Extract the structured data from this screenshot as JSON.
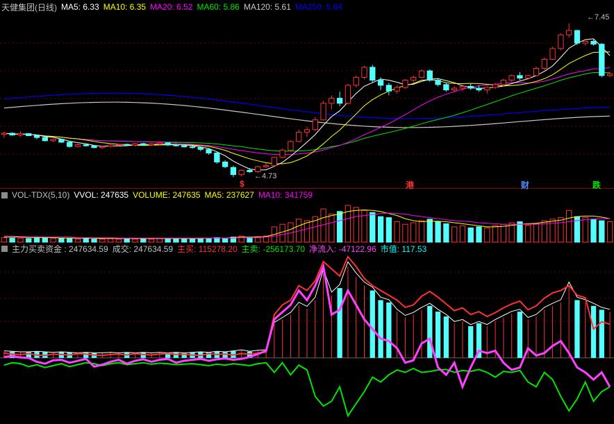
{
  "price_panel": {
    "title": "天健集团(日线)",
    "ma5_label": "MA5: 6.33",
    "ma10_label": "MA10: 6.35",
    "ma20_label": "MA20: 6.52",
    "ma60_label": "MA60: 5.86",
    "ma120_label": "MA120: 5.61",
    "ma250_label": "MA250: 5.64",
    "high_label": "7.45",
    "low_label": "4.73",
    "events": [
      "$",
      "港",
      "财",
      "跌"
    ]
  },
  "volume_panel": {
    "title": "VOL-TDX(5,10)",
    "vvol_label": "VVOL: 247635",
    "volume_label": "VOLUME: 247635",
    "ma5_label": "MA5: 237627",
    "ma10_label": "MA10: 341759"
  },
  "fund_panel": {
    "title": "主力买卖资金 : 247634.59",
    "deal_label": "成交: 247634.59",
    "buy_label": "主买: 115278.20",
    "sell_label": "主卖: -256173.70",
    "net_label": "净流入: -47122.96",
    "mktcap_label": "市值: 117.53"
  },
  "colors": {
    "up": "#ff3232",
    "down": "#54fcfc",
    "ma5": "#ffffff",
    "ma10": "#ffff00",
    "ma20": "#ff00ff",
    "ma60": "#00e600",
    "ma120": "#c8c8c8",
    "ma250": "#0000ff",
    "buy_line": "#ff3232",
    "sell_line": "#00e600",
    "net_line": "#ff40ff",
    "mktcap": "#00ffff"
  },
  "chart_data": {
    "type": "candlestick",
    "candles": [
      [
        5.92,
        6.0,
        5.82,
        5.95
      ],
      [
        5.95,
        5.97,
        5.88,
        5.9
      ],
      [
        5.9,
        6.0,
        5.85,
        5.94
      ],
      [
        5.94,
        5.95,
        5.87,
        5.88
      ],
      [
        5.88,
        5.9,
        5.78,
        5.83
      ],
      [
        5.83,
        5.86,
        5.72,
        5.74
      ],
      [
        5.74,
        5.8,
        5.7,
        5.78
      ],
      [
        5.78,
        5.8,
        5.68,
        5.7
      ],
      [
        5.7,
        5.73,
        5.55,
        5.58
      ],
      [
        5.58,
        5.66,
        5.55,
        5.63
      ],
      [
        5.63,
        5.66,
        5.58,
        5.6
      ],
      [
        5.6,
        5.62,
        5.53,
        5.55
      ],
      [
        5.55,
        5.6,
        5.52,
        5.58
      ],
      [
        5.58,
        5.64,
        5.55,
        5.62
      ],
      [
        5.62,
        5.66,
        5.6,
        5.64
      ],
      [
        5.64,
        5.66,
        5.6,
        5.62
      ],
      [
        5.62,
        5.68,
        5.58,
        5.66
      ],
      [
        5.66,
        5.68,
        5.6,
        5.62
      ],
      [
        5.62,
        5.68,
        5.6,
        5.65
      ],
      [
        5.65,
        5.7,
        5.62,
        5.68
      ],
      [
        5.68,
        5.7,
        5.6,
        5.62
      ],
      [
        5.62,
        5.66,
        5.58,
        5.6
      ],
      [
        5.6,
        5.64,
        5.55,
        5.57
      ],
      [
        5.57,
        5.6,
        5.52,
        5.55
      ],
      [
        5.55,
        5.58,
        5.45,
        5.5
      ],
      [
        5.5,
        5.52,
        5.35,
        5.4
      ],
      [
        5.4,
        5.42,
        5.1,
        5.15
      ],
      [
        5.15,
        5.2,
        4.98,
        5.02
      ],
      [
        5.0,
        5.05,
        4.73,
        4.8
      ],
      [
        4.8,
        4.95,
        4.75,
        4.92
      ],
      [
        4.92,
        4.98,
        4.85,
        4.88
      ],
      [
        4.88,
        5.05,
        4.85,
        5.02
      ],
      [
        5.02,
        5.12,
        4.98,
        5.05
      ],
      [
        5.05,
        5.3,
        5.02,
        5.28
      ],
      [
        5.28,
        5.52,
        5.25,
        5.48
      ],
      [
        5.48,
        5.75,
        5.45,
        5.72
      ],
      [
        5.72,
        6.05,
        5.7,
        5.98
      ],
      [
        5.98,
        6.12,
        5.85,
        6.05
      ],
      [
        6.05,
        6.4,
        6.0,
        6.32
      ],
      [
        6.32,
        6.85,
        6.3,
        6.78
      ],
      [
        6.78,
        7.0,
        6.62,
        6.92
      ],
      [
        6.92,
        7.1,
        6.7,
        6.78
      ],
      [
        6.78,
        7.32,
        6.75,
        7.28
      ],
      [
        7.28,
        7.55,
        7.22,
        7.5
      ],
      [
        7.5,
        7.82,
        7.45,
        7.78
      ],
      [
        7.78,
        7.85,
        7.35,
        7.42
      ],
      [
        7.42,
        7.5,
        7.15,
        7.28
      ],
      [
        7.28,
        7.35,
        7.0,
        7.12
      ],
      [
        7.12,
        7.28,
        7.05,
        7.22
      ],
      [
        7.22,
        7.45,
        7.18,
        7.42
      ],
      [
        7.42,
        7.55,
        7.35,
        7.5
      ],
      [
        7.5,
        7.72,
        7.48,
        7.68
      ],
      [
        7.68,
        7.72,
        7.38,
        7.42
      ],
      [
        7.42,
        7.48,
        7.25,
        7.3
      ],
      [
        7.3,
        7.35,
        7.1,
        7.15
      ],
      [
        7.15,
        7.25,
        7.08,
        7.2
      ],
      [
        7.2,
        7.3,
        7.12,
        7.25
      ],
      [
        7.25,
        7.32,
        7.15,
        7.2
      ],
      [
        7.2,
        7.28,
        7.1,
        7.15
      ],
      [
        7.15,
        7.25,
        7.05,
        7.22
      ],
      [
        7.22,
        7.35,
        7.18,
        7.3
      ],
      [
        7.3,
        7.45,
        7.25,
        7.42
      ],
      [
        7.42,
        7.58,
        7.38,
        7.55
      ],
      [
        7.55,
        7.65,
        7.42,
        7.48
      ],
      [
        7.48,
        7.58,
        7.45,
        7.55
      ],
      [
        7.55,
        7.8,
        7.52,
        7.75
      ],
      [
        7.75,
        8.05,
        7.7,
        8.0
      ],
      [
        8.0,
        8.35,
        7.98,
        8.3
      ],
      [
        8.3,
        8.72,
        8.25,
        8.68
      ],
      [
        8.68,
        9.0,
        8.6,
        8.8
      ],
      [
        8.8,
        8.82,
        8.4,
        8.45
      ],
      [
        8.45,
        8.5,
        8.38,
        8.5
      ],
      [
        8.5,
        8.55,
        8.38,
        8.42
      ],
      [
        8.42,
        8.45,
        7.5,
        7.55
      ],
      [
        7.55,
        7.65,
        7.5,
        7.6
      ]
    ],
    "volumes": [
      9,
      8,
      8,
      7,
      9,
      8,
      7,
      8,
      7,
      6,
      7,
      6,
      6,
      7,
      6,
      7,
      6,
      7,
      6,
      7,
      6,
      7,
      6,
      7,
      8,
      7,
      9,
      8,
      10,
      12,
      9,
      11,
      12,
      30,
      35,
      38,
      45,
      42,
      50,
      65,
      55,
      60,
      72,
      68,
      62,
      58,
      50,
      48,
      40,
      35,
      38,
      42,
      45,
      40,
      36,
      30,
      32,
      28,
      30,
      28,
      32,
      35,
      38,
      40,
      33,
      36,
      42,
      45,
      48,
      62,
      50,
      48,
      45,
      42,
      40
    ],
    "vol_ma5": [
      10,
      10,
      10,
      9,
      9,
      9,
      9,
      8,
      8,
      8,
      8,
      8,
      7,
      7,
      7,
      7,
      7,
      7,
      7,
      7,
      7,
      7,
      7,
      7,
      7,
      8,
      8,
      8,
      9,
      10,
      10,
      10,
      11,
      15,
      20,
      25,
      32,
      38,
      42,
      48,
      52,
      55,
      60,
      62,
      63,
      62,
      60,
      56,
      52,
      46,
      42,
      40,
      41,
      41,
      40,
      38,
      36,
      34,
      32,
      30,
      30,
      31,
      33,
      35,
      36,
      37,
      39,
      41,
      43,
      47,
      50,
      51,
      51,
      49,
      46
    ],
    "vol_ma10": [
      12,
      12,
      11,
      11,
      11,
      10,
      10,
      10,
      10,
      9,
      9,
      9,
      9,
      9,
      8,
      8,
      8,
      8,
      8,
      8,
      8,
      8,
      8,
      8,
      8,
      8,
      8,
      8,
      8,
      9,
      9,
      9,
      10,
      12,
      15,
      18,
      22,
      26,
      30,
      34,
      38,
      42,
      46,
      50,
      52,
      54,
      56,
      57,
      56,
      55,
      52,
      50,
      48,
      46,
      44,
      42,
      41,
      40,
      38,
      37,
      36,
      35,
      35,
      35,
      35,
      35,
      36,
      37,
      38,
      40,
      42,
      44,
      45,
      46,
      46
    ],
    "fund_bars": [
      14,
      13,
      12,
      12,
      13,
      12,
      11,
      12,
      11,
      10,
      11,
      10,
      10,
      11,
      10,
      11,
      10,
      11,
      10,
      11,
      10,
      11,
      10,
      11,
      12,
      11,
      13,
      12,
      14,
      16,
      13,
      15,
      16,
      70,
      80,
      90,
      110,
      102,
      120,
      175,
      130,
      145,
      190,
      168,
      150,
      140,
      120,
      115,
      96,
      84,
      90,
      100,
      108,
      96,
      86,
      72,
      76,
      66,
      72,
      66,
      76,
      84,
      92,
      96,
      80,
      86,
      100,
      108,
      115,
      150,
      120,
      115,
      108,
      100,
      96
    ],
    "buy_line": [
      10,
      8,
      7,
      9,
      6,
      5,
      8,
      7,
      6,
      9,
      8,
      6,
      5,
      7,
      8,
      6,
      9,
      7,
      6,
      8,
      9,
      7,
      8,
      6,
      5,
      9,
      7,
      8,
      6,
      9,
      8,
      10,
      12,
      90,
      110,
      120,
      150,
      140,
      160,
      200,
      185,
      170,
      210,
      190,
      165,
      150,
      140,
      130,
      120,
      105,
      110,
      128,
      138,
      126,
      112,
      98,
      104,
      90,
      96,
      86,
      94,
      104,
      112,
      118,
      100,
      108,
      124,
      135,
      140,
      150,
      130,
      125,
      60,
      75,
      70
    ],
    "sell_line": [
      -15,
      -10,
      -12,
      -18,
      -14,
      -20,
      -16,
      -12,
      -18,
      -14,
      -10,
      -12,
      -16,
      -12,
      -10,
      -14,
      -12,
      -10,
      -13,
      -11,
      -12,
      -14,
      -13,
      -12,
      -14,
      -16,
      -13,
      -15,
      -12,
      -14,
      -16,
      -12,
      -10,
      -30,
      -10,
      -35,
      -15,
      -25,
      -80,
      -100,
      -90,
      -60,
      -120,
      -95,
      -70,
      -40,
      -50,
      -35,
      -25,
      -30,
      -22,
      -30,
      -28,
      -25,
      -24,
      -30,
      -26,
      -28,
      -24,
      -30,
      -40,
      -28,
      -30,
      -26,
      -50,
      -60,
      -30,
      -45,
      -80,
      -110,
      -85,
      -50,
      -90,
      -70,
      -60
    ],
    "net_line": [
      2,
      4,
      1,
      0,
      -8,
      -12,
      -5,
      -4,
      -10,
      -6,
      -2,
      -18,
      -14,
      -8,
      -4,
      -12,
      -6,
      -3,
      -8,
      -4,
      -2,
      -10,
      -6,
      -4,
      -2,
      -6,
      -3,
      -1,
      -4,
      -2,
      2,
      8,
      15,
      80,
      95,
      110,
      140,
      120,
      150,
      190,
      90,
      100,
      140,
      110,
      80,
      60,
      40,
      35,
      20,
      -10,
      -5,
      30,
      40,
      -20,
      -35,
      -10,
      -60,
      -20,
      15,
      10,
      15,
      -10,
      -25,
      -20,
      20,
      5,
      10,
      25,
      35,
      10,
      -20,
      -30,
      -45,
      -30,
      -60
    ],
    "ylim_price": [
      4.6,
      9.3
    ],
    "ylim_volume": [
      0,
      80
    ],
    "ylim_fund": [
      -130,
      210
    ]
  }
}
